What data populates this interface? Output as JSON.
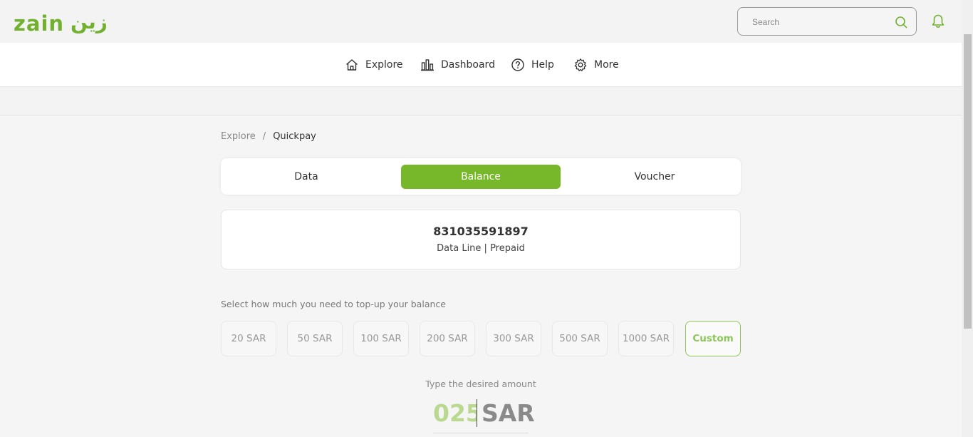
{
  "brand": {
    "latin": "zain",
    "arabic": "زين",
    "accent": "#72b12f"
  },
  "header": {
    "search": {
      "placeholder": "Search",
      "value": ""
    }
  },
  "nav": {
    "items": [
      {
        "label": "Explore",
        "icon": "home-icon"
      },
      {
        "label": "Dashboard",
        "icon": "bar-chart-icon"
      },
      {
        "label": "Help",
        "icon": "question-circle-icon"
      },
      {
        "label": "More",
        "icon": "gear-icon"
      }
    ]
  },
  "breadcrumb": {
    "root": "Explore",
    "separator": "/",
    "current": "Quickpay"
  },
  "tabs": [
    {
      "label": "Data",
      "active": false
    },
    {
      "label": "Balance",
      "active": true
    },
    {
      "label": "Voucher",
      "active": false
    }
  ],
  "line": {
    "number": "831035591897",
    "type": "Data Line | Prepaid"
  },
  "topup": {
    "prompt": "Select how much you need to top-up your balance",
    "amounts": [
      "20 SAR",
      "50 SAR",
      "100 SAR",
      "200 SAR",
      "300 SAR",
      "500 SAR",
      "1000 SAR"
    ],
    "custom_label": "Custom",
    "type_label": "Type the desired amount",
    "entered_value": "025",
    "unit": "SAR"
  }
}
